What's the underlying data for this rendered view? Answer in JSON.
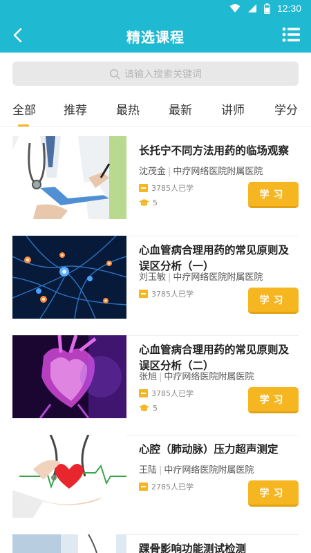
{
  "status_bar": {
    "time": "12:30"
  },
  "header": {
    "title": "精选课程"
  },
  "search": {
    "placeholder": "请输入搜索关键词"
  },
  "tabs": [
    "全部",
    "推荐",
    "最热",
    "最新",
    "讲师",
    "学分"
  ],
  "courses": [
    {
      "title": "长托宁不同方法用药的临场观察",
      "teacher": "沈茂金",
      "hospital": "中疗网络医院附属医院",
      "learners": "3785人已学",
      "credit": "5",
      "button": "学习",
      "thumb": "doctor-clipboard"
    },
    {
      "title": "心血管病合理用药的常见原则及误区分析（一）",
      "teacher": "刘玉敏",
      "hospital": "中疗网络医院附属医院",
      "learners": "3785人已学",
      "button": "学习",
      "thumb": "neurons"
    },
    {
      "title": "心血管病合理用药的常见原则及误区分析（二）",
      "teacher": "张旭",
      "hospital": "中疗网络医院附属医院",
      "learners": "3785人已学",
      "credit": "5",
      "button": "学习",
      "thumb": "heart"
    },
    {
      "title": "心腔（肺动脉）压力超声测定",
      "teacher": "王陆",
      "hospital": "中疗网络医院附属医院",
      "learners": "2785人已学",
      "button": "学习",
      "thumb": "hands-heart"
    },
    {
      "title": "踝骨影响功能测试检测",
      "thumb": "doctor"
    }
  ],
  "colors": {
    "primary": "#1fb9d2",
    "accent": "#f5b621"
  }
}
